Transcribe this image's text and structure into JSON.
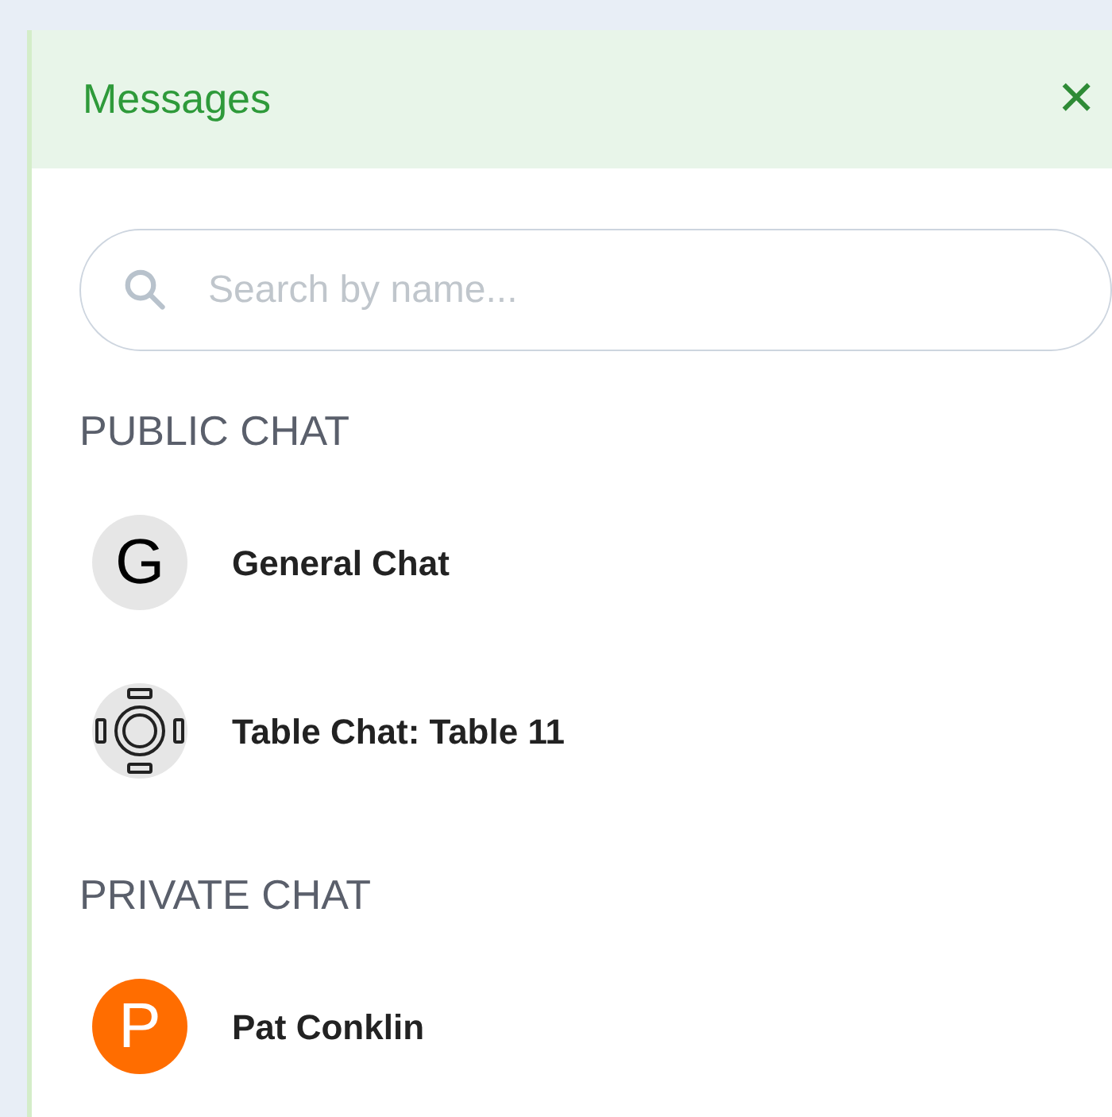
{
  "panel": {
    "title": "Messages",
    "close": "✕"
  },
  "search": {
    "placeholder": "Search by name..."
  },
  "sections": [
    {
      "heading": "PUBLIC CHAT",
      "chats": [
        {
          "name": "General Chat",
          "kind": "letter",
          "letter": "G",
          "color": "#e6e6e6"
        },
        {
          "name": "Table Chat: Table 11",
          "kind": "table"
        }
      ]
    },
    {
      "heading": "PRIVATE CHAT",
      "chats": [
        {
          "name": "Pat Conklin",
          "kind": "letter",
          "letter": "P",
          "color": "#ff6d00"
        }
      ]
    }
  ]
}
